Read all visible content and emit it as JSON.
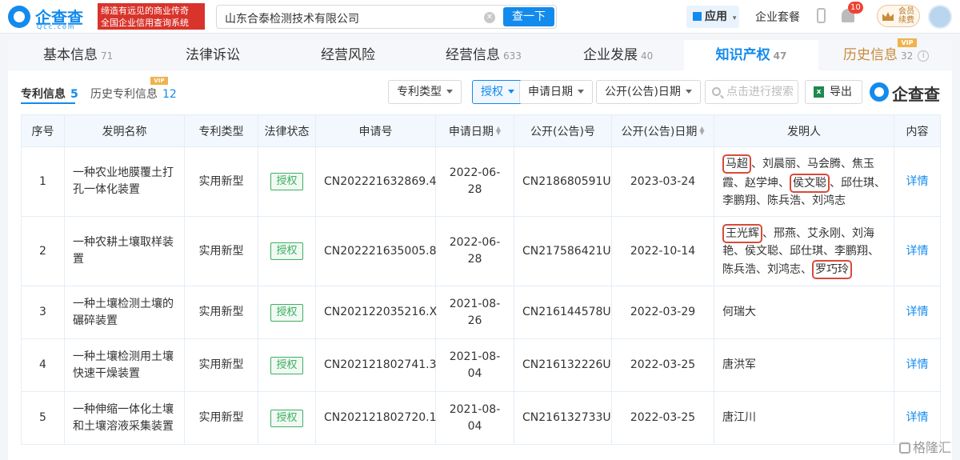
{
  "header": {
    "logo_cn": "企查查",
    "logo_en": "Qcc.com",
    "slogan_line1": "缔造有远见的商业传奇",
    "slogan_line2": "全国企业信用查询系统",
    "search_value": "山东合泰检测技术有限公司",
    "search_button": "查一下",
    "app_label": "应用",
    "suite_label": "企业套餐",
    "notification_count": "10",
    "vip_label_1": "会员",
    "vip_label_2": "续费"
  },
  "tabs": [
    {
      "label": "基本信息",
      "count": "71"
    },
    {
      "label": "法律诉讼",
      "count": ""
    },
    {
      "label": "经营风险",
      "count": ""
    },
    {
      "label": "经营信息",
      "count": "633"
    },
    {
      "label": "企业发展",
      "count": "40"
    },
    {
      "label": "知识产权",
      "count": "47"
    },
    {
      "label": "历史信息",
      "count": "32"
    }
  ],
  "vip_badge": "VIP",
  "subtabs": [
    {
      "label": "专利信息",
      "count": "5"
    },
    {
      "label": "历史专利信息",
      "count": "12"
    }
  ],
  "filters": {
    "patent_type": "专利类型",
    "legal_status": "授权",
    "apply_date": "申请日期",
    "publish_date": "公开(公告)日期",
    "search_placeholder": "点击进行搜索",
    "export": "导出",
    "brand": "企查查"
  },
  "table": {
    "headers": [
      "序号",
      "发明名称",
      "专利类型",
      "法律状态",
      "申请号",
      "申请日期",
      "公开(公告)号",
      "公开(公告)日期",
      "发明人",
      "内容"
    ],
    "rows": [
      {
        "index": "1",
        "name": "一种农业地膜覆土打孔一体化装置",
        "type": "实用新型",
        "status": "授权",
        "apply_no": "CN202221632869.4",
        "apply_date": "2022-06-28",
        "pub_no": "CN218680591U",
        "pub_date": "2023-03-24",
        "detail": "详情",
        "inventors": {
          "h1": "马超",
          "a": "、刘晨丽、马会腾、焦玉霞、赵学坤、",
          "h2": "侯文聪",
          "b": "、邱仕琪、李鹏翔、陈兵浩、刘鸿志"
        }
      },
      {
        "index": "2",
        "name": "一种农耕土壤取样装置",
        "type": "实用新型",
        "status": "授权",
        "apply_no": "CN202221635005.8",
        "apply_date": "2022-06-28",
        "pub_no": "CN217586421U",
        "pub_date": "2022-10-14",
        "detail": "详情",
        "inventors": {
          "h1": "王光辉",
          "a": "、邢燕、艾永刚、刘海艳、侯文聪、邱仕琪、李鹏翔、陈兵浩、刘鸿志、",
          "h2": "罗巧玲",
          "b": ""
        }
      },
      {
        "index": "3",
        "name": "一种土壤检测土壤的碾碎装置",
        "type": "实用新型",
        "status": "授权",
        "apply_no": "CN202122035216.X",
        "apply_date": "2021-08-26",
        "pub_no": "CN216144578U",
        "pub_date": "2022-03-29",
        "detail": "详情",
        "inventor_plain": "何瑞大"
      },
      {
        "index": "4",
        "name": "一种土壤检测用土壤快速干燥装置",
        "type": "实用新型",
        "status": "授权",
        "apply_no": "CN202121802741.3",
        "apply_date": "2021-08-04",
        "pub_no": "CN216132226U",
        "pub_date": "2022-03-25",
        "detail": "详情",
        "inventor_plain": "唐洪军"
      },
      {
        "index": "5",
        "name": "一种伸缩一体化土壤和土壤溶液采集装置",
        "type": "实用新型",
        "status": "授权",
        "apply_no": "CN202121802720.1",
        "apply_date": "2021-08-04",
        "pub_no": "CN216132733U",
        "pub_date": "2022-03-25",
        "detail": "详情",
        "inventor_plain": "唐江川"
      }
    ]
  },
  "watermark": "格隆汇",
  "colors": {
    "primary": "#128bed",
    "granted": "#3fae63",
    "highlight": "#d94a3a",
    "vip": "#c98b3a"
  }
}
